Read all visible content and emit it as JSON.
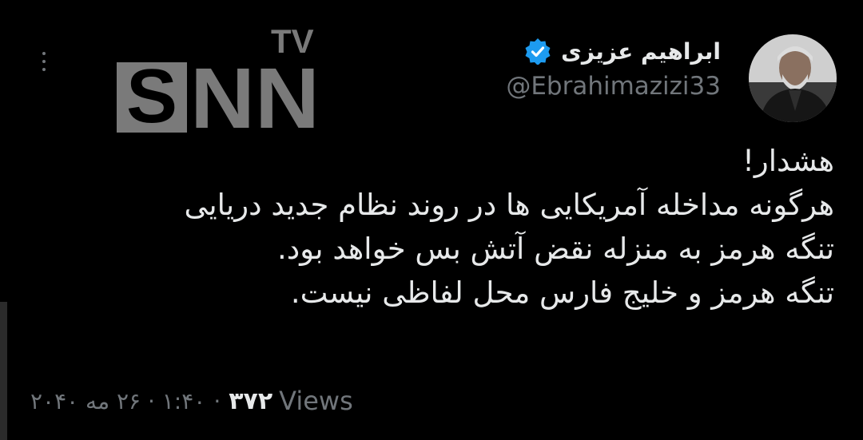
{
  "author": {
    "display_name": "ابراهیم عزیزی",
    "handle": "@Ebrahimazizi33",
    "verified": true,
    "verified_color": "#1d9bf0"
  },
  "tweet": {
    "lines": [
      "هشدار!",
      "هرگونه مداخله آمریکایی ها در روند نظام جدید دریایی",
      "تنگه هرمز به منزله نقض آتش بس خواهد بود.",
      "تنگه هرمز و خلیج فارس محل لفاظی نیست."
    ]
  },
  "meta": {
    "time_date": "۱:۴۰ · ۲۶ مه ۲۰۴۰",
    "separator": "·",
    "views_count": "۳۷۲",
    "views_label": "Views"
  },
  "watermark": {
    "brand": "SNN",
    "suffix": "TV",
    "color": "#7a7a7a"
  },
  "icons": {
    "more": "more-vertical-icon",
    "verified": "verified-badge-icon"
  },
  "colors": {
    "background": "#000000",
    "primary_text": "#e7e9ea",
    "secondary_text": "#71767b"
  }
}
